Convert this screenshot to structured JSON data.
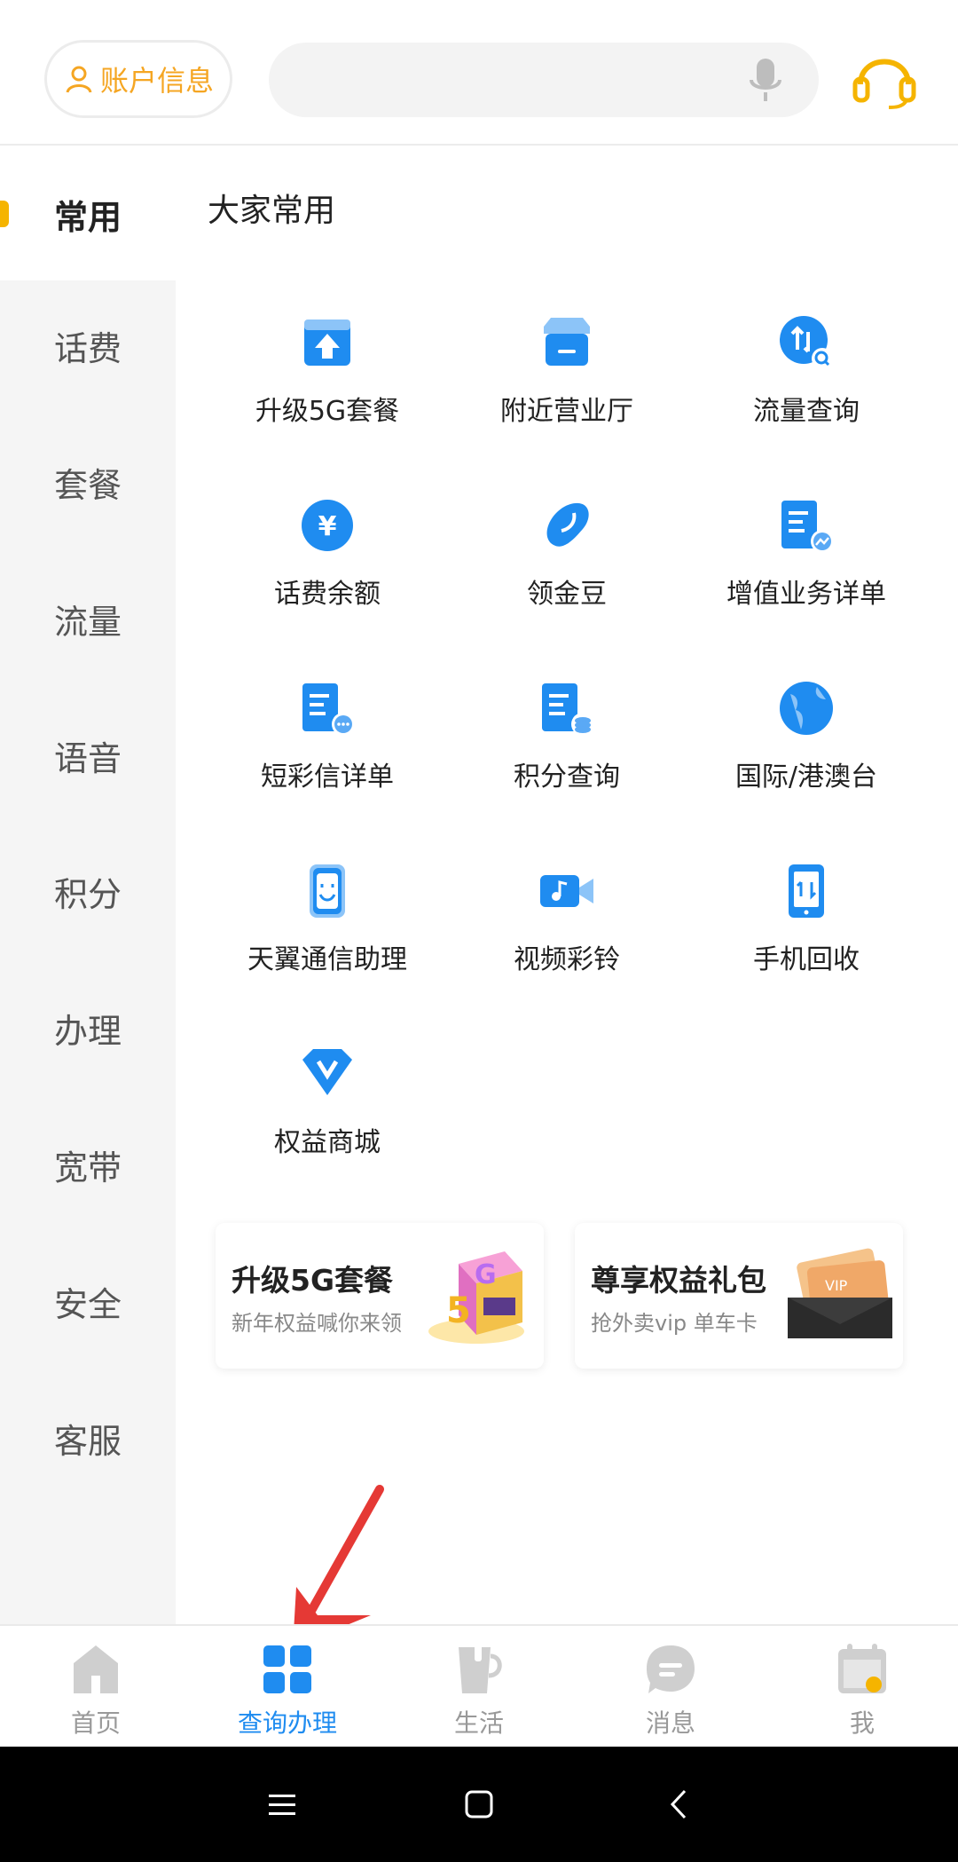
{
  "header": {
    "account_label": "账户信息",
    "search_placeholder": ""
  },
  "sidebar": {
    "items": [
      {
        "label": "常用",
        "active": true
      },
      {
        "label": "话费"
      },
      {
        "label": "套餐"
      },
      {
        "label": "流量"
      },
      {
        "label": "语音"
      },
      {
        "label": "积分"
      },
      {
        "label": "办理"
      },
      {
        "label": "宽带"
      },
      {
        "label": "安全"
      },
      {
        "label": "客服"
      }
    ]
  },
  "main": {
    "section_title": "大家常用",
    "grid": [
      {
        "label": "升级5G套餐",
        "icon": "upgrade-icon"
      },
      {
        "label": "附近营业厅",
        "icon": "store-icon"
      },
      {
        "label": "流量查询",
        "icon": "data-query-icon"
      },
      {
        "label": "话费余额",
        "icon": "yuan-icon"
      },
      {
        "label": "领金豆",
        "icon": "bean-icon"
      },
      {
        "label": "增值业务详单",
        "icon": "value-added-list-icon"
      },
      {
        "label": "短彩信详单",
        "icon": "sms-list-icon"
      },
      {
        "label": "积分查询",
        "icon": "points-list-icon"
      },
      {
        "label": "国际/港澳台",
        "icon": "globe-icon"
      },
      {
        "label": "天翼通信助理",
        "icon": "assistant-phone-icon"
      },
      {
        "label": "视频彩铃",
        "icon": "video-ringtone-icon"
      },
      {
        "label": "手机回收",
        "icon": "phone-recycle-icon"
      },
      {
        "label": "权益商城",
        "icon": "vip-mall-icon"
      }
    ],
    "promos": [
      {
        "title": "升级5G套餐",
        "subtitle": "新年权益喊你来领"
      },
      {
        "title": "尊享权益礼包",
        "subtitle": "抢外卖vip 单车卡"
      }
    ]
  },
  "bottom_nav": [
    {
      "label": "首页",
      "icon": "home-icon"
    },
    {
      "label": "查询办理",
      "icon": "grid-icon",
      "active": true
    },
    {
      "label": "生活",
      "icon": "cup-icon"
    },
    {
      "label": "消息",
      "icon": "message-icon"
    },
    {
      "label": "我",
      "icon": "calendar-sign-icon"
    }
  ],
  "colors": {
    "accent": "#1f8cf0",
    "brand_orange": "#f5a623",
    "active_marker": "#f5b400",
    "arrow": "#e53935"
  }
}
